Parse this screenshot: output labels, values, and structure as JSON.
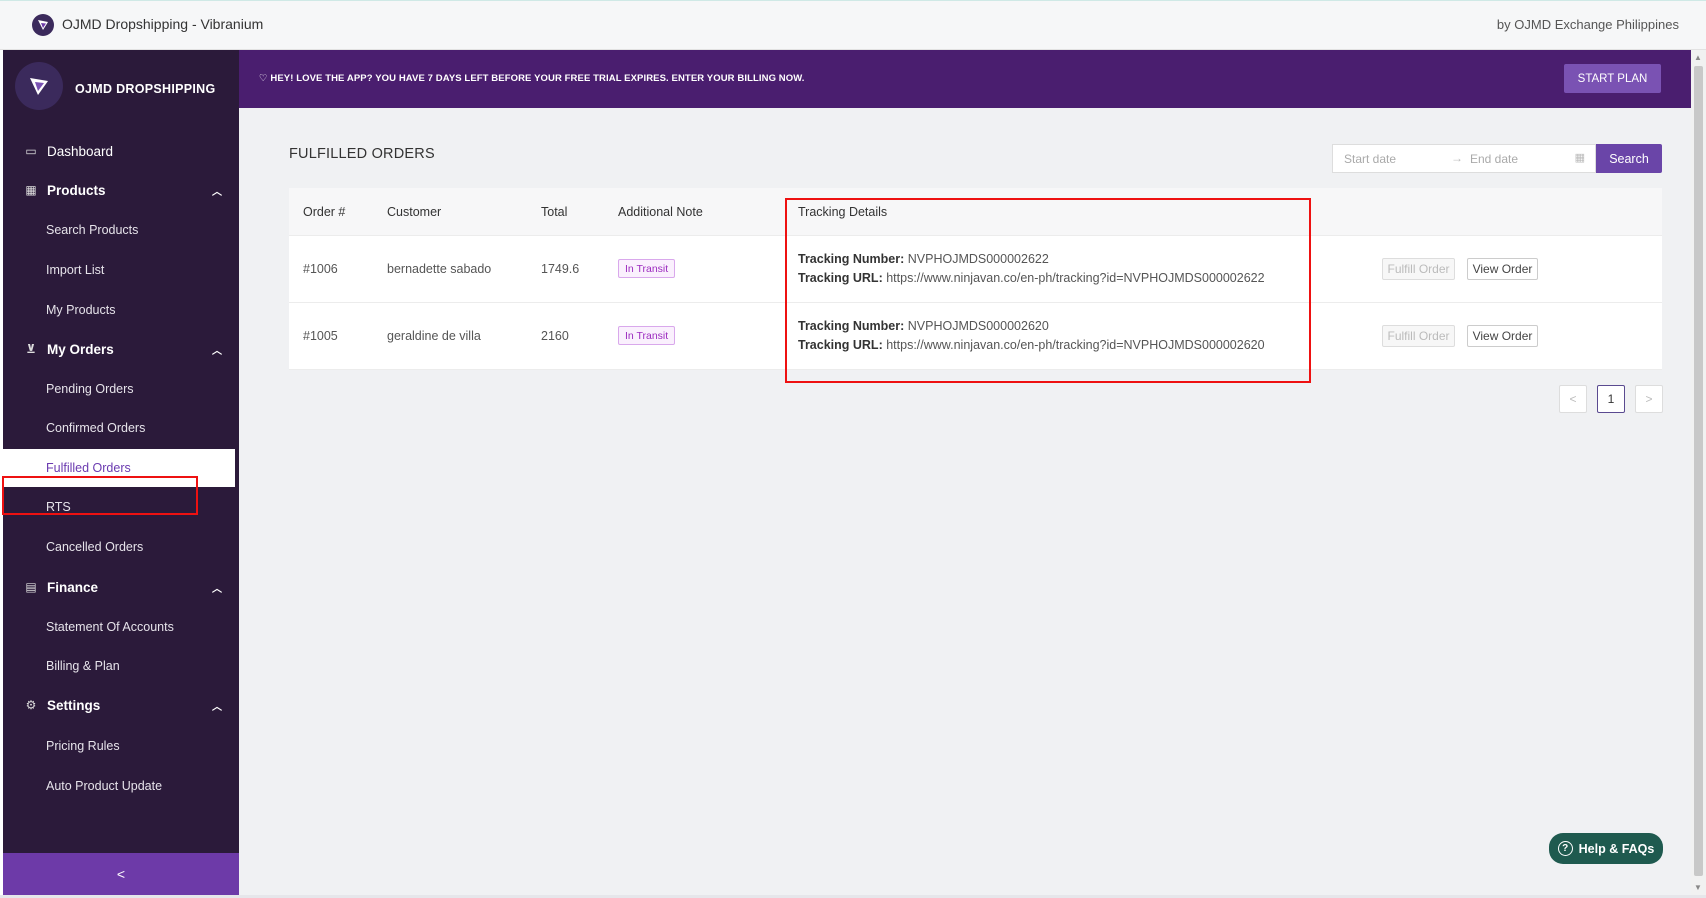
{
  "app": {
    "title": "OJMD Dropshipping - Vibranium",
    "by": "by OJMD Exchange Philippines",
    "brand": "OJMD DROPSHIPPING"
  },
  "banner": {
    "message": "♡ HEY! LOVE THE APP? YOU HAVE 7 DAYS LEFT BEFORE YOUR FREE TRIAL EXPIRES. ENTER YOUR BILLING NOW.",
    "button": "START PLAN"
  },
  "sidebar": {
    "dashboard": "Dashboard",
    "products": "Products",
    "search_products": "Search Products",
    "import_list": "Import List",
    "my_products": "My Products",
    "my_orders": "My Orders",
    "pending_orders": "Pending Orders",
    "confirmed_orders": "Confirmed Orders",
    "fulfilled_orders": "Fulfilled Orders",
    "rts": "RTS",
    "cancelled_orders": "Cancelled Orders",
    "finance": "Finance",
    "statement": "Statement Of Accounts",
    "billing": "Billing & Plan",
    "settings": "Settings",
    "pricing_rules": "Pricing Rules",
    "auto_update": "Auto Product Update",
    "collapse": "<"
  },
  "main": {
    "title": "FULFILLED ORDERS",
    "start_placeholder": "Start date",
    "end_placeholder": "End date",
    "range_arrow": "→",
    "search": "Search",
    "columns": {
      "order": "Order #",
      "customer": "Customer",
      "total": "Total",
      "note": "Additional Note",
      "tracking": "Tracking Details"
    },
    "rows": [
      {
        "order": "#1006",
        "customer": "bernadette sabado",
        "total": "1749.6",
        "note": "In Transit",
        "tracking_number_label": "Tracking Number:",
        "tracking_number": " NVPHOJMDS000002622",
        "tracking_url_label": "Tracking URL:",
        "tracking_url": " https://www.ninjavan.co/en-ph/tracking?id=NVPHOJMDS000002622",
        "fulfill": "Fulfill Order",
        "view": "View Order"
      },
      {
        "order": "#1005",
        "customer": "geraldine de villa",
        "total": "2160",
        "note": "In Transit",
        "tracking_number_label": "Tracking Number:",
        "tracking_number": " NVPHOJMDS000002620",
        "tracking_url_label": "Tracking URL:",
        "tracking_url": " https://www.ninjavan.co/en-ph/tracking?id=NVPHOJMDS000002620",
        "fulfill": "Fulfill Order",
        "view": "View Order"
      }
    ],
    "pagination": {
      "prev": "<",
      "current": "1",
      "next": ">"
    }
  },
  "help": {
    "label": "Help & FAQs",
    "icon": "?"
  }
}
